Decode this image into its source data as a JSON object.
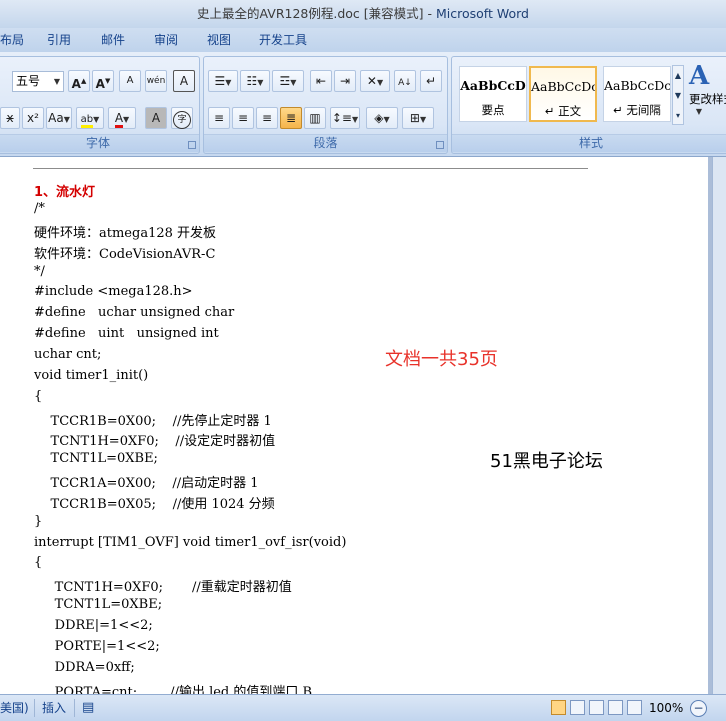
{
  "window": {
    "title": "史上最全的AVR128例程.doc [兼容模式] - ",
    "app_name": "Microsoft Word"
  },
  "ribbon_tabs": [
    "布局",
    "引用",
    "邮件",
    "审阅",
    "视图",
    "开发工具"
  ],
  "font_group": {
    "label": "字体",
    "font_size": "五号",
    "buttons": {
      "grow": "A",
      "shrink": "A",
      "clear": "A",
      "phonetic": "wén",
      "border_char": "A",
      "strike": "x",
      "superscript": "x²",
      "change_case": "Aa",
      "highlight": "ab",
      "font_color": "A",
      "shade_char": "A",
      "enclose_char": "字"
    }
  },
  "paragraph_group": {
    "label": "段落"
  },
  "styles_group": {
    "label": "样式",
    "styles": [
      {
        "preview": "AaBbCcD",
        "name": "要点"
      },
      {
        "preview": "AaBbCcDc",
        "name": "↵ 正文"
      },
      {
        "preview": "AaBbCcDc",
        "name": "↵ 无间隔"
      }
    ],
    "change_styles": "更改样式"
  },
  "document": {
    "heading": "1、流水灯",
    "lines": [
      "/*",
      "硬件环境：atmega128 开发板",
      "软件环境：CodeVisionAVR-C",
      "*/",
      "#include <mega128.h>",
      "#define   uchar unsigned char",
      "#define   uint   unsigned int",
      "uchar cnt;",
      "void timer1_init()",
      "{",
      "    TCCR1B=0X00;    //先停止定时器 1",
      "    TCNT1H=0XF0;    //设定定时器初值",
      "    TCNT1L=0XBE;",
      "    TCCR1A=0X00;    //启动定时器 1",
      "    TCCR1B=0X05;    //使用 1024 分频",
      "}",
      "interrupt [TIM1_OVF] void timer1_ovf_isr(void)",
      "{",
      "     TCNT1H=0XF0;       //重载定时器初值",
      "     TCNT1L=0XBE;",
      "     DDRE|=1<<2;",
      "     PORTE|=1<<2;",
      "     DDRA=0xff;",
      "     PORTA=cnt;        //输出 led 的值到端口 B"
    ],
    "watermark_pages": "文档一共35页",
    "watermark_forum": "51黑电子论坛"
  },
  "status_bar": {
    "language": "美国)",
    "insert_mode": "插入",
    "zoom": "100%",
    "zoom_out": "−"
  },
  "colors": {
    "heading_red": "#d40000",
    "watermark_red": "#e8322a",
    "ribbon_blue": "#15428b"
  }
}
